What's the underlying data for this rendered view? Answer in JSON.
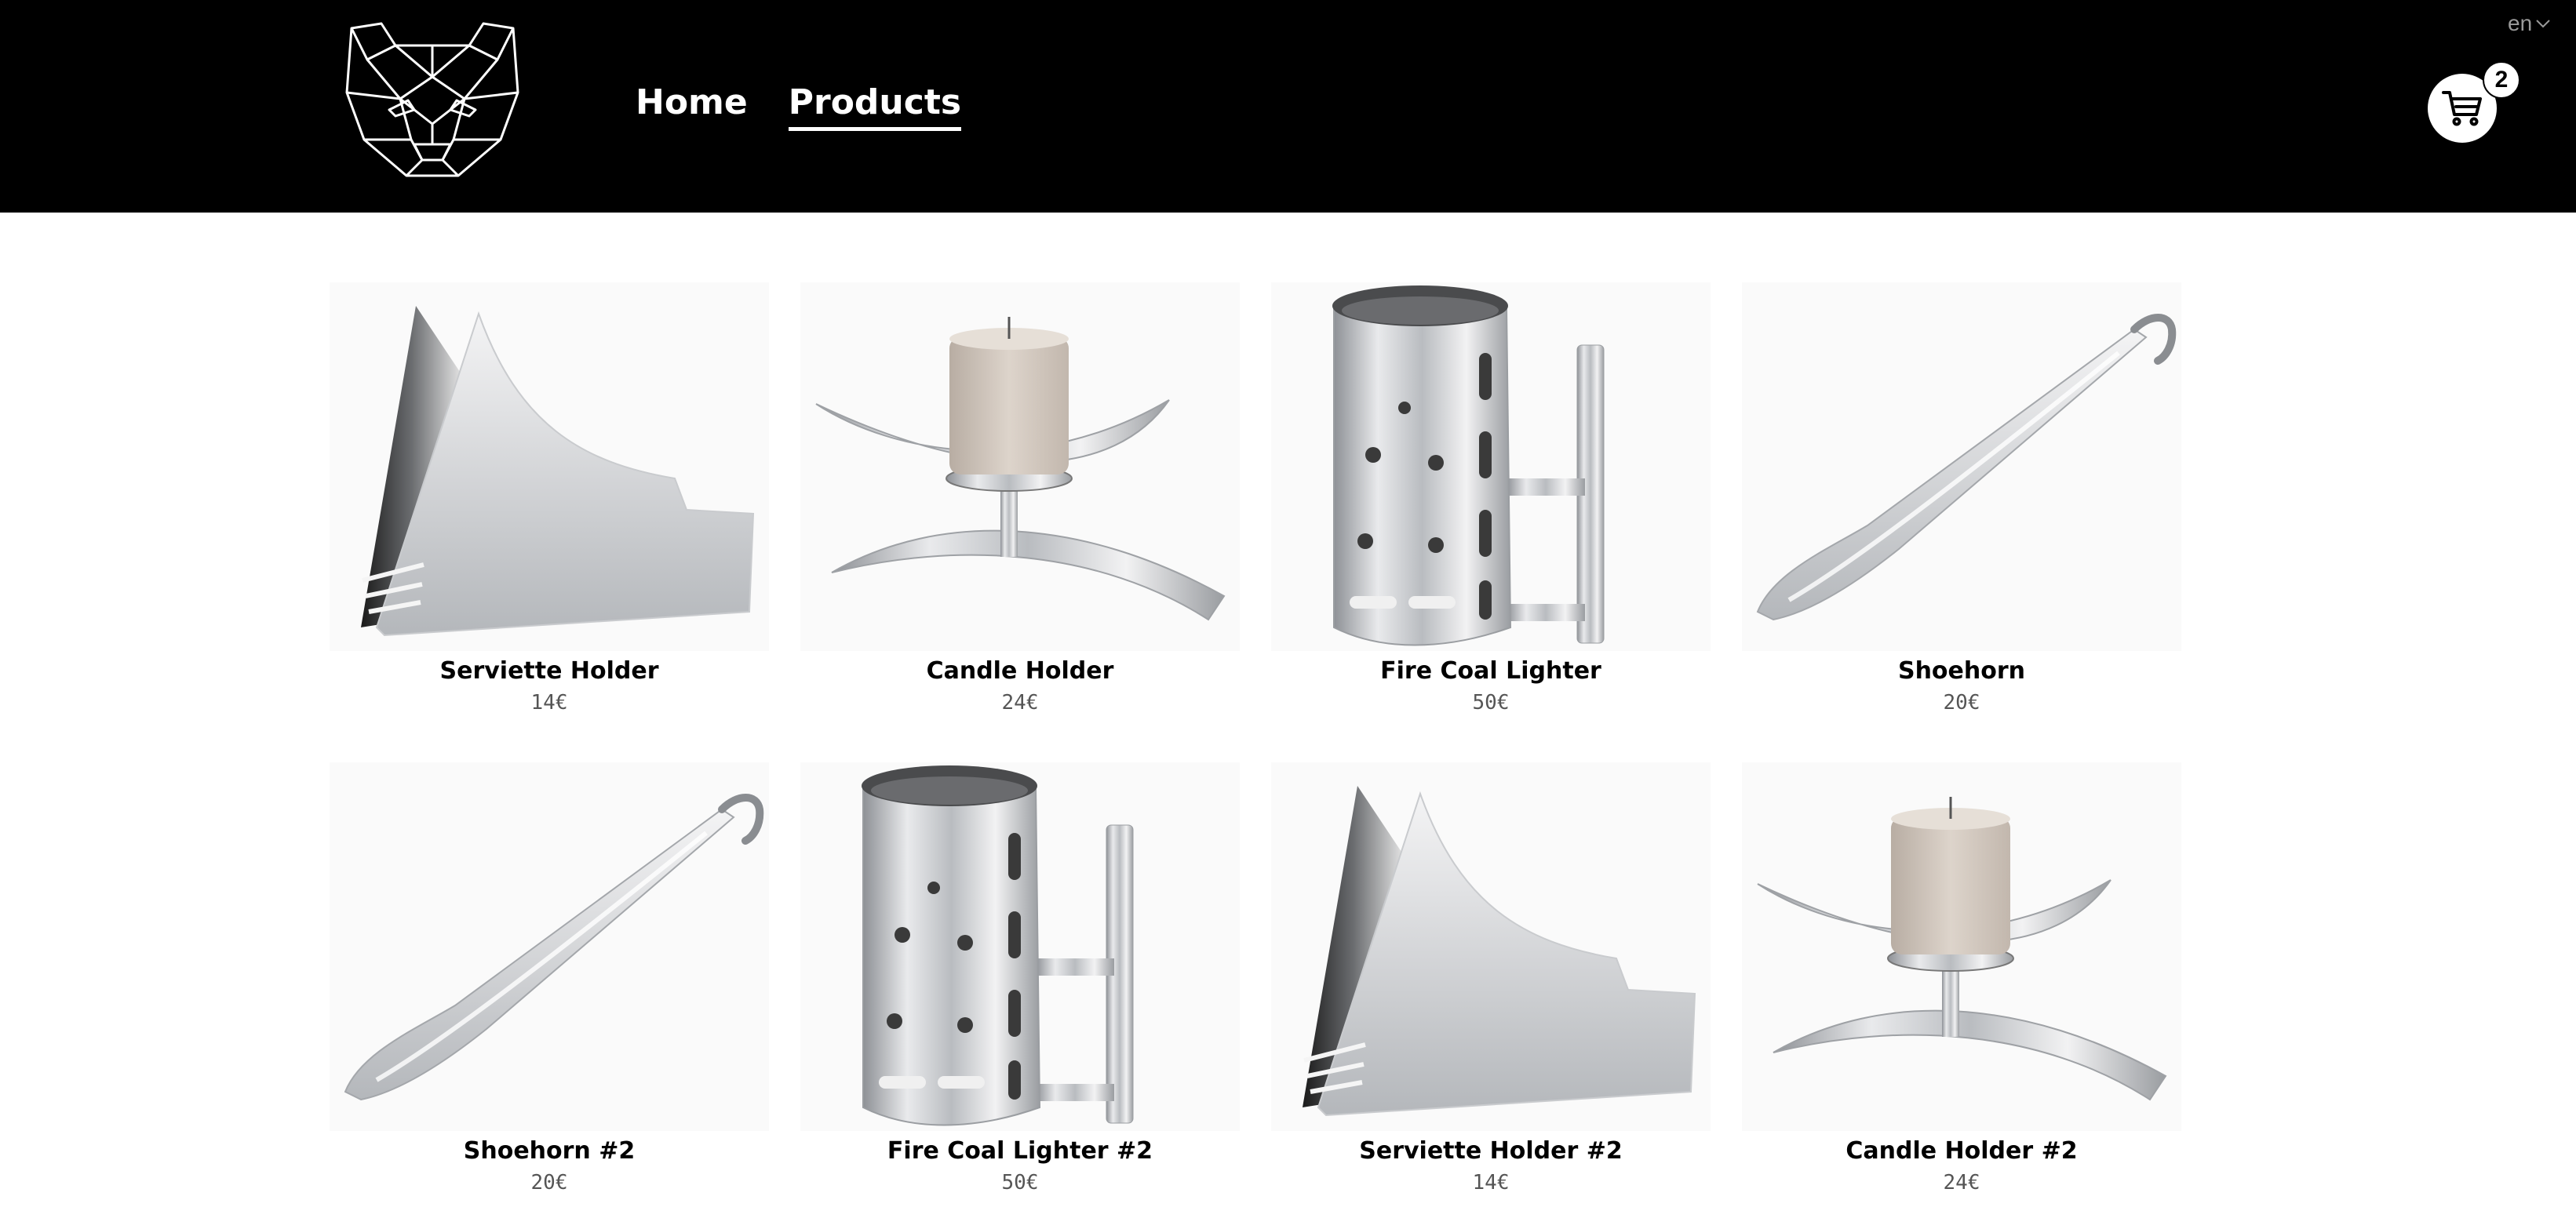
{
  "header": {
    "logo_icon": "bear-head-logo",
    "nav": [
      {
        "label": "Home",
        "active": false
      },
      {
        "label": "Products",
        "active": true
      }
    ],
    "language": "en",
    "cart": {
      "icon": "shopping-cart-icon",
      "count": "2"
    }
  },
  "products": [
    {
      "name": "Serviette Holder",
      "price": "14€",
      "kind": "serviette"
    },
    {
      "name": "Candle Holder",
      "price": "24€",
      "kind": "candle"
    },
    {
      "name": "Fire Coal Lighter",
      "price": "50€",
      "kind": "lighter"
    },
    {
      "name": "Shoehorn",
      "price": "20€",
      "kind": "shoehorn"
    },
    {
      "name": "Shoehorn #2",
      "price": "20€",
      "kind": "shoehorn"
    },
    {
      "name": "Fire Coal Lighter #2",
      "price": "50€",
      "kind": "lighter"
    },
    {
      "name": "Serviette Holder #2",
      "price": "14€",
      "kind": "serviette"
    },
    {
      "name": "Candle Holder #2",
      "price": "24€",
      "kind": "candle"
    }
  ]
}
